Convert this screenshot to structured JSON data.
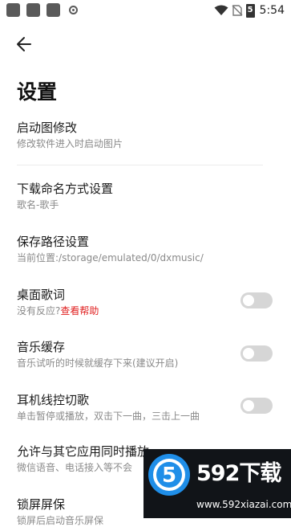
{
  "status_bar": {
    "time": "5:54",
    "battery": "5"
  },
  "header": {
    "title": "设置"
  },
  "settings": [
    {
      "title": "启动图修改",
      "subtitle": "修改软件进入时启动图片"
    },
    {
      "title": "下载命名方式设置",
      "subtitle": "歌名-歌手"
    },
    {
      "title": "保存路径设置",
      "subtitle": "当前位置:/storage/emulated/0/dxmusic/"
    },
    {
      "title": "桌面歌词",
      "subtitle": "没有反应?",
      "link": "查看帮助",
      "toggle": false
    },
    {
      "title": "音乐缓存",
      "subtitle": "音乐试听的时候就缓存下来(建议开启)",
      "toggle": false
    },
    {
      "title": "耳机线控切歌",
      "subtitle": "单击暂停或播放，双击下一曲，三击上一曲",
      "toggle": false
    },
    {
      "title": "允许与其它应用同时播放",
      "subtitle": "微信语音、电话接入等不会"
    },
    {
      "title": "锁屏屏保",
      "subtitle": "锁屏后启动音乐屏保"
    }
  ],
  "watermark": {
    "brand": "592下载",
    "url": "www.592xiazai.com",
    "logo_digit": "5"
  },
  "colors": {
    "link": "#e02020",
    "toggle_off": "#d6d6d6",
    "title": "#111111",
    "subtitle": "#8a8a8a",
    "logo_blue": "#1f8ee8"
  }
}
